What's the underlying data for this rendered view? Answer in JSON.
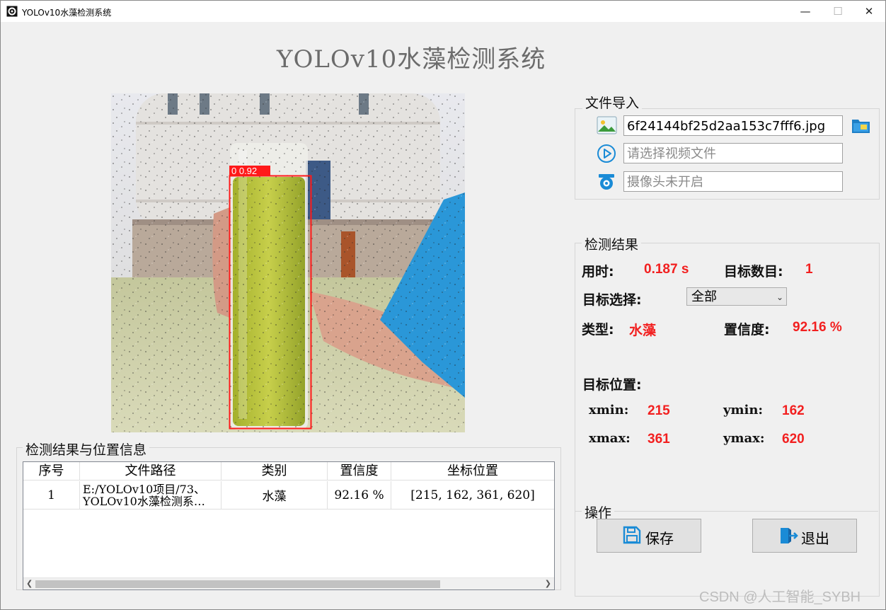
{
  "window": {
    "title": "YOLOv10水藻检测系统",
    "minimize": "—",
    "maximize": "☐",
    "close": "✕"
  },
  "app_title": "YOLOv10水藻检测系统",
  "image_view": {
    "detection_label": "0 0.92"
  },
  "file_import": {
    "title": "文件导入",
    "image_path": "6f24144bf25d2aa153c7fff6.jpg",
    "video_placeholder": "请选择视频文件",
    "camera_status": "摄像头未开启"
  },
  "results": {
    "title": "检测结果",
    "time_label": "用时:",
    "time_value": "0.187 s",
    "count_label": "目标数目:",
    "count_value": "1",
    "target_select_label": "目标选择:",
    "target_select_value": "全部",
    "type_label": "类型:",
    "type_value": "水藻",
    "conf_label": "置信度:",
    "conf_value": "92.16 %",
    "position_label": "目标位置:",
    "xmin_label": "xmin:",
    "xmin_value": "215",
    "ymin_label": "ymin:",
    "ymin_value": "162",
    "xmax_label": "xmax:",
    "xmax_value": "361",
    "ymax_label": "ymax:",
    "ymax_value": "620"
  },
  "operations": {
    "title": "操作",
    "save_label": "保存",
    "exit_label": "退出"
  },
  "table": {
    "title": "检测结果与位置信息",
    "headers": [
      "序号",
      "文件路径",
      "类别",
      "置信度",
      "坐标位置"
    ],
    "rows": [
      {
        "index": "1",
        "path_line1": "E:/YOLOv10项目/73、",
        "path_line2": "YOLOv10水藻检测系…",
        "class": "水藻",
        "confidence": "92.16 %",
        "coords": "[215, 162, 361, 620]"
      }
    ]
  },
  "watermark": "CSDN @人工智能_SYBH",
  "colors": {
    "accent_red": "#f21f1f",
    "icon_blue": "#1a8bd6"
  }
}
